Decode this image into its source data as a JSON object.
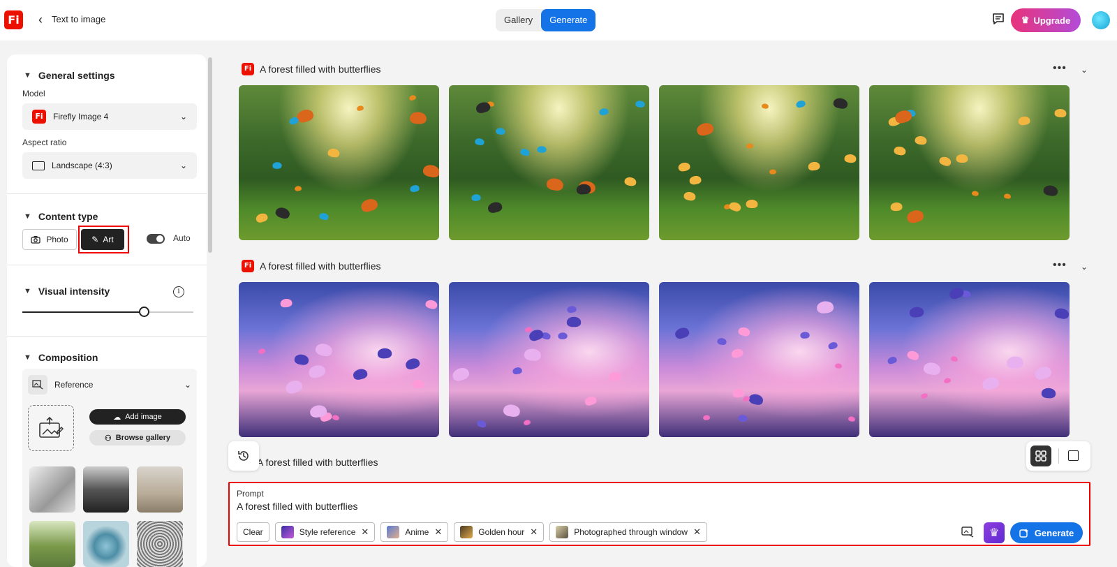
{
  "header": {
    "logo_text": "Fi",
    "breadcrumb": "Text to image",
    "tabs": [
      {
        "label": "Gallery"
      },
      {
        "label": "Generate",
        "active": true
      }
    ],
    "upgrade_label": "Upgrade"
  },
  "sidebar": {
    "general": {
      "title": "General settings",
      "model_label": "Model",
      "model_value": "Firefly Image 4",
      "aspect_label": "Aspect ratio",
      "aspect_value": "Landscape (4:3)"
    },
    "content_type": {
      "title": "Content type",
      "photo_label": "Photo",
      "art_label": "Art",
      "auto_label": "Auto",
      "selected": "Art"
    },
    "visual_intensity": {
      "title": "Visual intensity",
      "value_fraction": 0.72
    },
    "composition": {
      "title": "Composition",
      "reference_label": "Reference",
      "add_image_label": "Add image",
      "browse_label": "Browse gallery"
    }
  },
  "gallery": {
    "groups": [
      {
        "title": "A forest filled with butterflies",
        "theme": "forest"
      },
      {
        "title": "A forest filled with butterflies",
        "theme": "window"
      },
      {
        "title": "A forest filled with butterflies",
        "theme": "partial"
      }
    ]
  },
  "prompt": {
    "label": "Prompt",
    "text": "A forest filled with butterflies",
    "clear_label": "Clear",
    "chips": [
      {
        "label": "Style reference",
        "color": "#7b4fd6"
      },
      {
        "label": "Anime",
        "color": "#6a8fd8"
      },
      {
        "label": "Golden hour",
        "color": "#c99a3a"
      },
      {
        "label": "Photographed through window",
        "color": "#8a7a5a"
      }
    ],
    "generate_label": "Generate"
  },
  "colors": {
    "accent": "#1473e6",
    "brand": "#eb1000",
    "highlight": "#ee0000"
  }
}
